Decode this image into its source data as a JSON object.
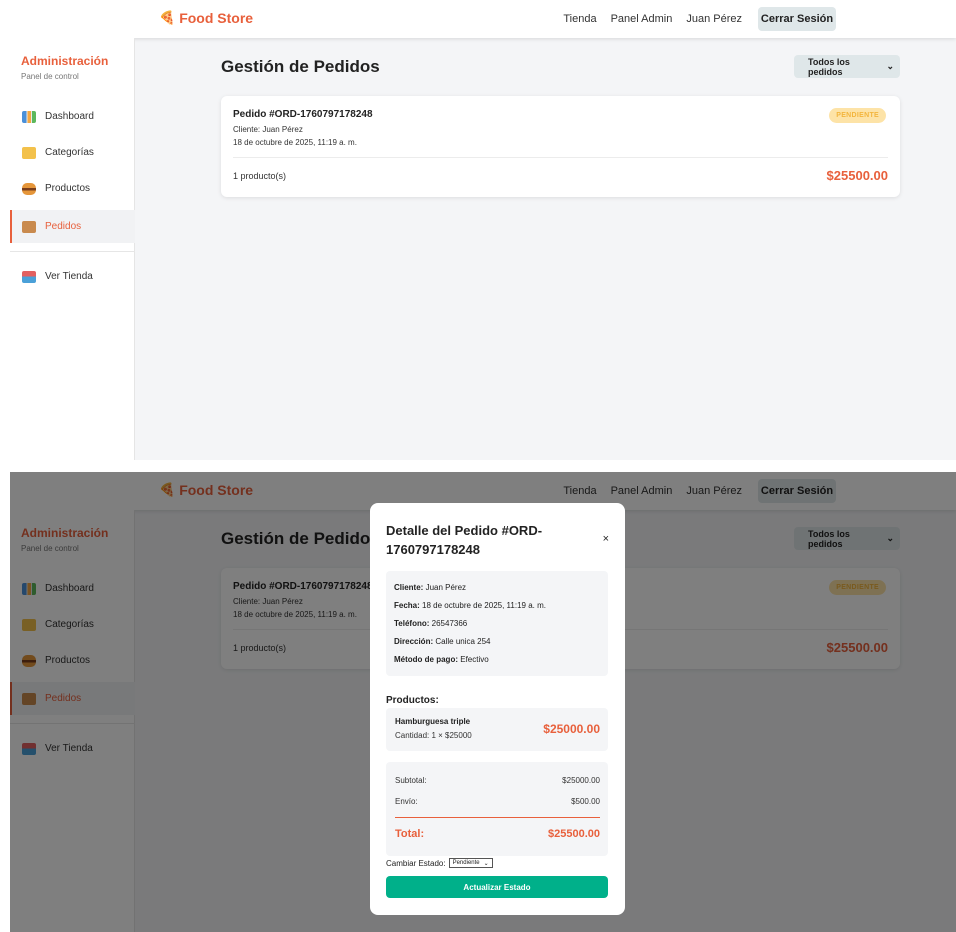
{
  "navbar": {
    "brand": "Food Store",
    "brand_icon": "pizza-icon",
    "links": [
      "Tienda",
      "Panel Admin",
      "Juan Pérez"
    ],
    "logout_label": "Cerrar Sesión"
  },
  "sidebar": {
    "title": "Administración",
    "subtitle": "Panel de control",
    "items": [
      {
        "label": "Dashboard",
        "icon": "chart-icon"
      },
      {
        "label": "Categorías",
        "icon": "folder-icon"
      },
      {
        "label": "Productos",
        "icon": "burger-icon"
      },
      {
        "label": "Pedidos",
        "icon": "box-icon"
      },
      {
        "label": "Ver Tienda",
        "icon": "store-icon"
      }
    ],
    "active_item": "Pedidos"
  },
  "main": {
    "title": "Gestión de Pedidos",
    "filter_value": "Todos los pedidos"
  },
  "order": {
    "id_label": "Pedido #ORD-1760797178248",
    "client": "Cliente: Juan Pérez",
    "date": "18 de octubre de 2025, 11:19 a. m.",
    "status": "PENDIENTE",
    "count": "1 producto(s)",
    "total": "$25500.00"
  },
  "modal": {
    "title": "Detalle del Pedido #ORD-1760797178248",
    "close": "×",
    "info": [
      {
        "label": "Cliente:",
        "value": "Juan Pérez"
      },
      {
        "label": "Fecha:",
        "value": "18 de octubre de 2025, 11:19 a. m."
      },
      {
        "label": "Teléfono:",
        "value": "26547366"
      },
      {
        "label": "Dirección:",
        "value": "Calle unica 254"
      },
      {
        "label": "Método de pago:",
        "value": "Efectivo"
      }
    ],
    "products_title": "Productos:",
    "product": {
      "name": "Hamburguesa triple",
      "qty": "Cantidad: 1 × $25000",
      "price": "$25000.00"
    },
    "subtotal_label": "Subtotal:",
    "subtotal_value": "$25000.00",
    "shipping_label": "Envío:",
    "shipping_value": "$500.00",
    "total_label": "Total:",
    "total_value": "$25500.00",
    "status_label": "Cambiar Estado:",
    "status_value": "Pendiente",
    "update_label": "Actualizar Estado"
  },
  "colors": {
    "accent": "#e8603c",
    "success": "#00b08a",
    "pending_bg": "#fde3a7"
  }
}
